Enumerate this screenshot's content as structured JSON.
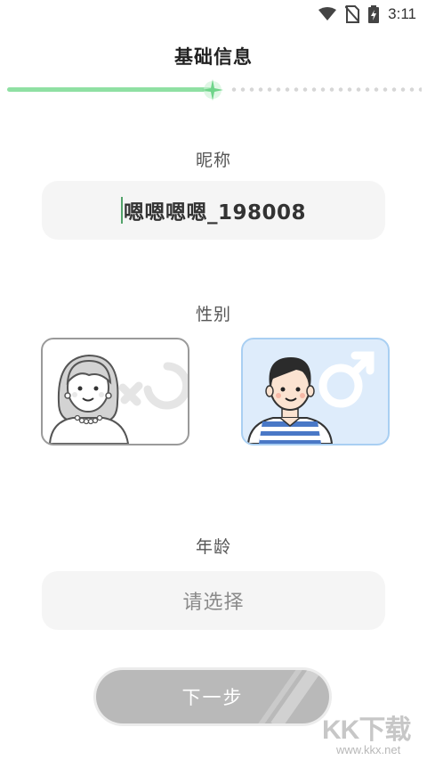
{
  "status_bar": {
    "time": "3:11",
    "icons": [
      "wifi-icon",
      "no-sim-icon",
      "battery-charging-icon"
    ]
  },
  "header": {
    "title": "基础信息"
  },
  "progress": {
    "step": 1,
    "total_steps": 2,
    "fraction": 0.5,
    "accent_color": "#8fe0a3"
  },
  "nickname": {
    "label": "昵称",
    "value": "嗯嗯嗯嗯_198008"
  },
  "gender": {
    "label": "性别",
    "options": [
      {
        "id": "female",
        "icon": "female-symbol-icon",
        "selected": false
      },
      {
        "id": "male",
        "icon": "male-symbol-icon",
        "selected": true
      }
    ],
    "selected_color": "#deecfb"
  },
  "age": {
    "label": "年龄",
    "placeholder": "请选择"
  },
  "next_button": {
    "label": "下一步",
    "color": "#b9b9b9"
  },
  "watermark": {
    "logo": "KK下载",
    "url": "www.kkx.net"
  }
}
